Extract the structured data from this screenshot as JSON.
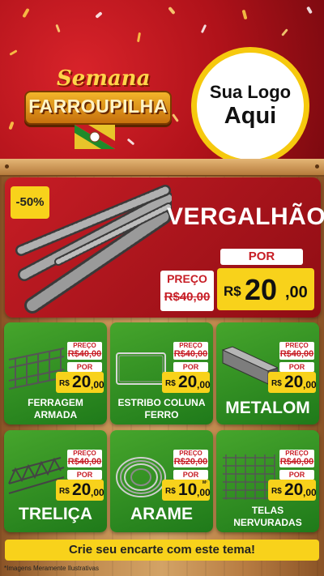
{
  "header": {
    "brand_line1": "Semana",
    "brand_line2": "FARROUPILHA",
    "logo_line1": "Sua Logo",
    "logo_line2": "Aqui"
  },
  "hero": {
    "discount": "-50%",
    "title": "VERGALHÃO",
    "por_label": "POR",
    "preco_label": "PREÇO",
    "old_price": "R$40,00",
    "currency": "R$",
    "price_int": "20",
    "price_dec": ",00",
    "image_icon": "rebar-bundle-icon"
  },
  "cards": [
    {
      "name_lines": [
        "FERRAGEM",
        "ARMADA"
      ],
      "preco_label": "PREÇO",
      "old_price": "R$40,00",
      "por_label": "POR",
      "currency": "R$",
      "price_int": "20",
      "price_dec": ",00",
      "unit": "",
      "icon": "rebar-cage-icon"
    },
    {
      "name_lines": [
        "ESTRIBO COLUNA",
        "FERRO"
      ],
      "preco_label": "PREÇO",
      "old_price": "R$40,00",
      "por_label": "POR",
      "currency": "R$",
      "price_int": "20",
      "price_dec": ",00",
      "unit": "",
      "icon": "stirrup-icon"
    },
    {
      "name_lines": [
        "METALOM"
      ],
      "preco_label": "PREÇO",
      "old_price": "R$40,00",
      "por_label": "POR",
      "currency": "R$",
      "price_int": "20",
      "price_dec": ",00",
      "unit": "",
      "icon": "metal-tube-icon"
    },
    {
      "name_lines": [
        "TRELIÇA"
      ],
      "preco_label": "PREÇO",
      "old_price": "R$40,00",
      "por_label": "POR",
      "currency": "R$",
      "price_int": "20",
      "price_dec": ",00",
      "unit": "",
      "icon": "truss-icon"
    },
    {
      "name_lines": [
        "ARAME"
      ],
      "preco_label": "PREÇO",
      "old_price": "R$20,00",
      "por_label": "POR",
      "currency": "R$",
      "price_int": "10",
      "price_dec": ",00",
      "unit": "M²",
      "icon": "wire-coil-icon"
    },
    {
      "name_lines": [
        "TELAS",
        "NERVURADAS"
      ],
      "preco_label": "PREÇO",
      "old_price": "R$40,00",
      "por_label": "POR",
      "currency": "R$",
      "price_int": "20",
      "price_dec": ",00",
      "unit": "",
      "icon": "mesh-icon"
    }
  ],
  "footer": {
    "cta": "Crie seu encarte com este tema!",
    "disclaimer": "*Imagens Meramente Ilustrativas"
  },
  "colors": {
    "red": "#c71d25",
    "green": "#2f8f22",
    "yellow": "#f8d21b",
    "wood": "#c08a4e"
  }
}
